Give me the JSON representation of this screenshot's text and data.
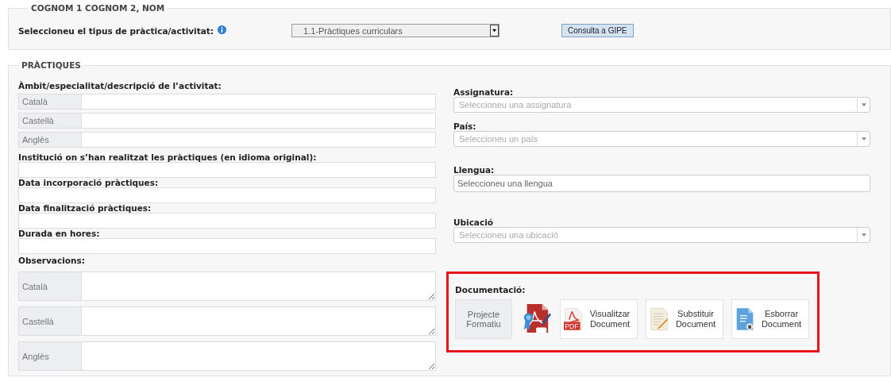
{
  "student_panel": {
    "legend": "COGNOM 1 COGNOM 2, NOM",
    "type_label": "Seleccioneu el tipus de pràctica/activitat:",
    "type_select": {
      "value": "1.1-Pràctiques curriculars"
    },
    "gipe_button": "Consulta a GIPE"
  },
  "practices": {
    "legend": "PRÀCTIQUES",
    "description": {
      "label": "Àmbit/especialitat/descripció de l’activitat:",
      "fields": [
        {
          "language": "Català"
        },
        {
          "language": "Castellà"
        },
        {
          "language": "Anglès"
        }
      ]
    },
    "fields": [
      {
        "label": "Institució on s’han realitzat les pràctiques (en idioma original):"
      },
      {
        "label": "Data incorporació pràctiques:"
      },
      {
        "label": "Data finalització pràctiques:"
      },
      {
        "label": "Durada en hores:"
      }
    ],
    "observations": {
      "label": "Observacions:",
      "fields": [
        {
          "language": "Català"
        },
        {
          "language": "Castellà"
        },
        {
          "language": "Anglès"
        }
      ]
    },
    "right_fields": [
      {
        "label": "Assignatura:",
        "kind": "select",
        "placeholder": "Seleccioneu una assignatura"
      },
      {
        "label": "País:",
        "kind": "select",
        "placeholder": "Seleccioneu un país"
      },
      {
        "label": "Llengua:",
        "kind": "text",
        "placeholder": "Seleccioneu una llengua"
      },
      {
        "label": "Ubicació",
        "kind": "select",
        "placeholder": "Seleccioneu una ubicació"
      }
    ],
    "documentation": {
      "label": "Documentació:",
      "highlighted": true,
      "buttons": [
        {
          "kind": "project",
          "label": "Projecte Formatiu"
        },
        {
          "kind": "signed"
        },
        {
          "kind": "view",
          "label": "Visualitzar Document",
          "badge": "PDF"
        },
        {
          "kind": "replace",
          "label": "Substituir Document"
        },
        {
          "kind": "delete",
          "label": "Esborrar Document"
        }
      ]
    }
  }
}
